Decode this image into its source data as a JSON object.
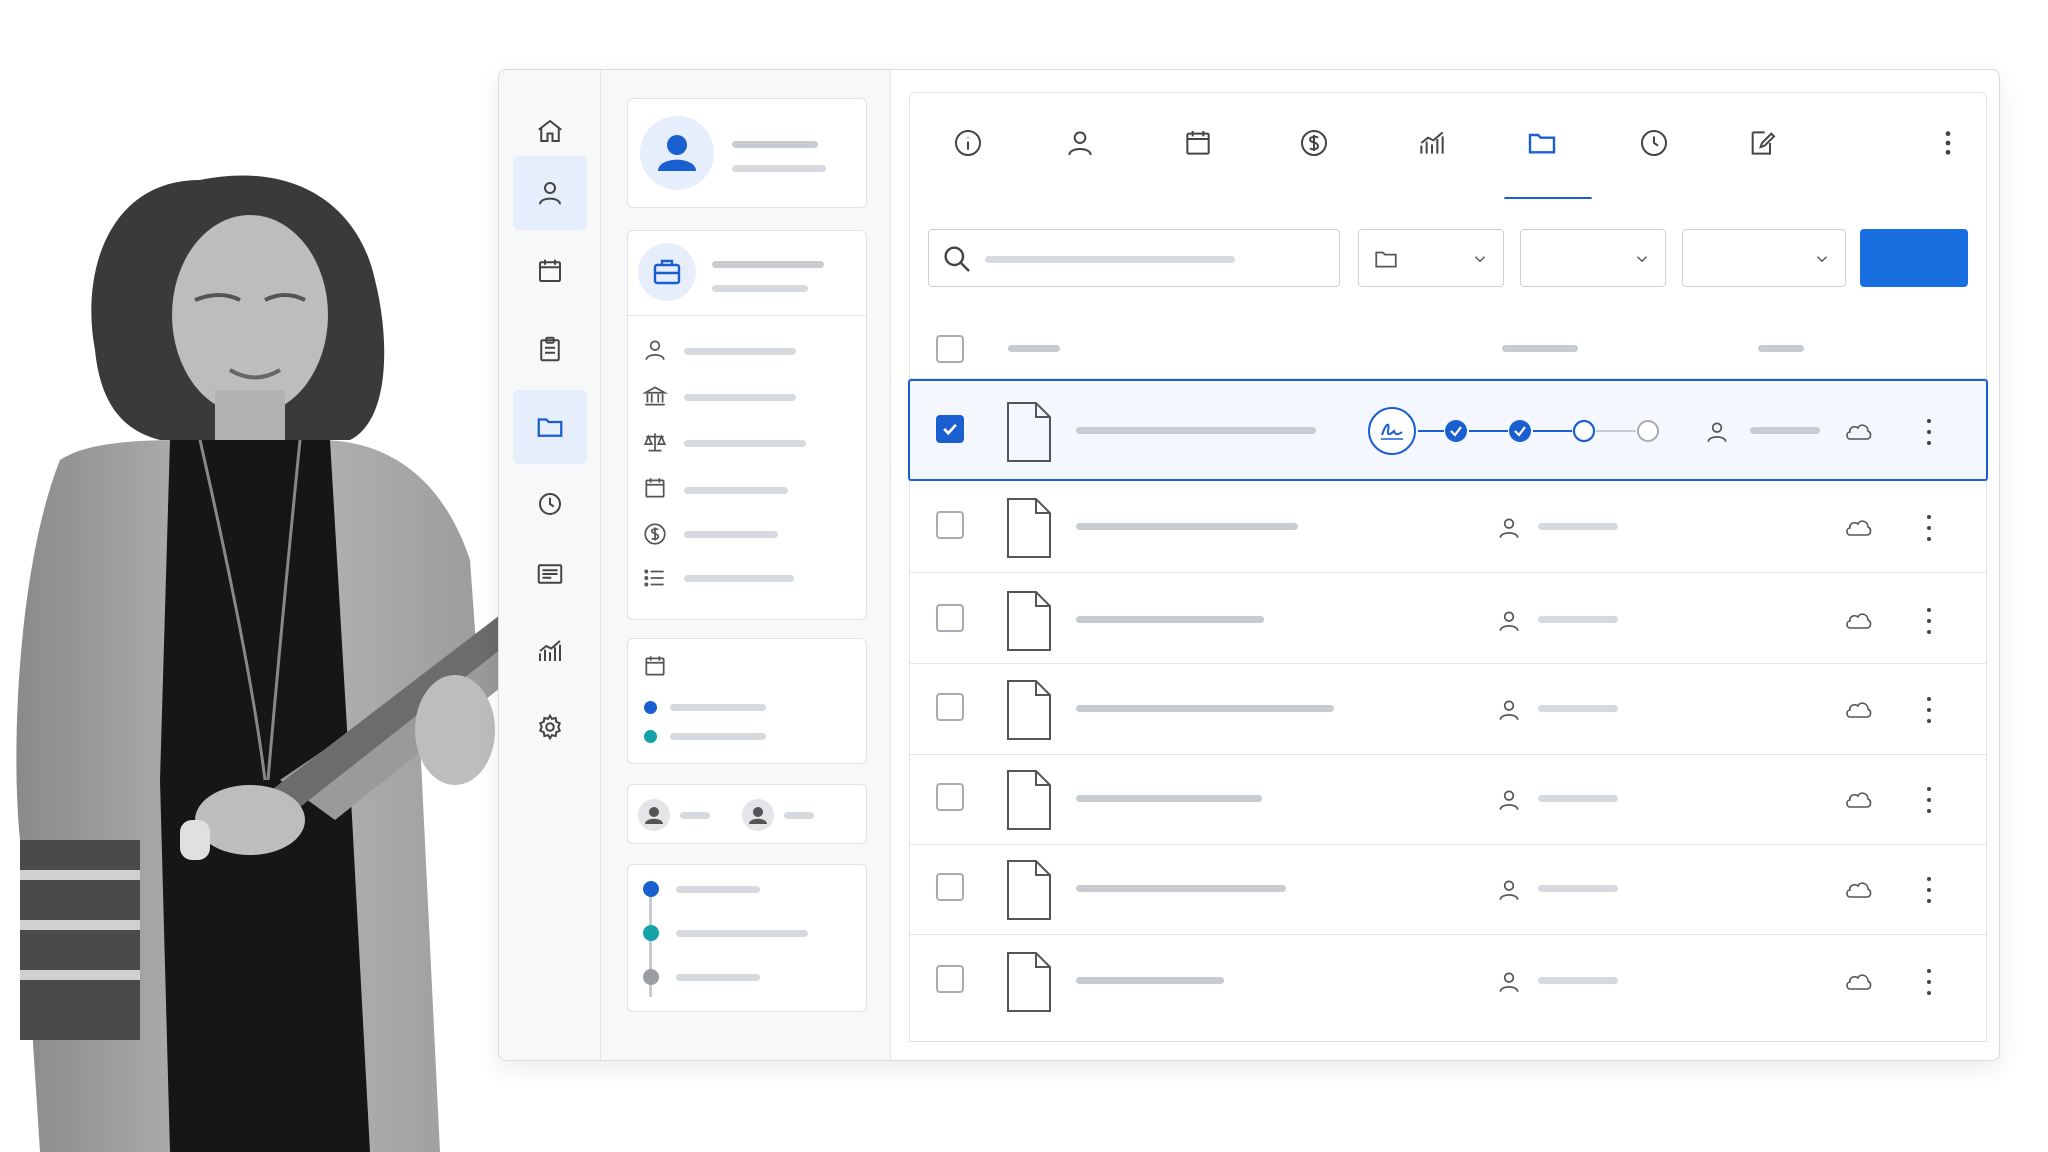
{
  "app": {
    "accent_color": "#1a5fd0",
    "primary_button_color": "#1a6fe0",
    "teal_color": "#14a3a8",
    "rail": {
      "items": [
        {
          "icon": "home-icon"
        },
        {
          "icon": "user-icon",
          "active": true
        },
        {
          "icon": "calendar-icon"
        },
        {
          "icon": "clipboard-icon"
        },
        {
          "icon": "folder-icon",
          "active": true
        },
        {
          "icon": "clock-icon"
        },
        {
          "icon": "list-icon"
        },
        {
          "icon": "chart-icon"
        },
        {
          "icon": "gear-icon"
        }
      ]
    },
    "tabs": [
      {
        "icon": "info-icon"
      },
      {
        "icon": "user-icon"
      },
      {
        "icon": "calendar-icon"
      },
      {
        "icon": "dollar-icon"
      },
      {
        "icon": "chart-icon"
      },
      {
        "icon": "folder-icon",
        "active": true
      },
      {
        "icon": "clock-icon"
      },
      {
        "icon": "edit-icon"
      },
      {
        "icon": "more-vertical-icon"
      }
    ],
    "toolbar": {
      "search_icon": "search-icon",
      "filters": [
        {
          "icon": "folder-icon",
          "chevron": "chevron-down-icon"
        },
        {
          "chevron": "chevron-down-icon"
        },
        {
          "chevron": "chevron-down-icon"
        }
      ]
    },
    "table": {
      "rows": [
        {
          "selected": true,
          "workflow": {
            "icon": "signature-icon",
            "steps": [
              "done",
              "done",
              "current",
              "pending"
            ]
          },
          "status_icon": "cloud-icon"
        },
        {
          "selected": false,
          "status_icon": "cloud-icon"
        },
        {
          "selected": false,
          "status_icon": "cloud-icon"
        },
        {
          "selected": false,
          "status_icon": "cloud-icon"
        },
        {
          "selected": false,
          "status_icon": "cloud-icon"
        },
        {
          "selected": false,
          "status_icon": "cloud-icon"
        },
        {
          "selected": false,
          "status_icon": "cloud-icon"
        }
      ]
    },
    "panel": {
      "profile_icon": "user-icon",
      "matter_icon": "briefcase-icon",
      "detail_icons": [
        "user-icon",
        "bank-icon",
        "scale-icon",
        "calendar-icon",
        "dollar-icon",
        "list-icon"
      ],
      "events_icon": "calendar-icon",
      "timeline_colors": [
        "#1a5fd0",
        "#14a3a8",
        "#9a9ea4"
      ]
    }
  }
}
